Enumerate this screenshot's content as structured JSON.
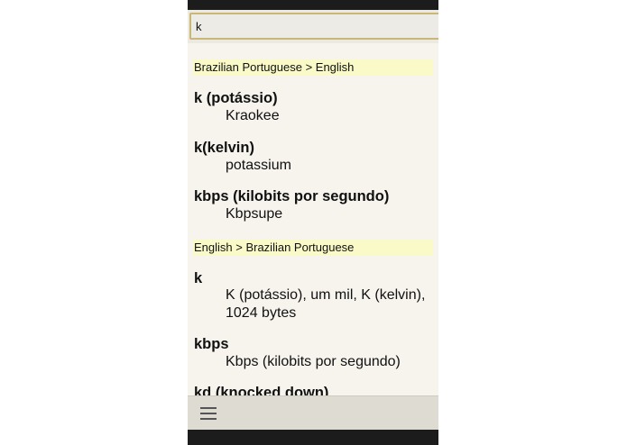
{
  "search": {
    "value": "k"
  },
  "sections": [
    {
      "header": "Brazilian Portuguese > English",
      "entries": [
        {
          "term": "k (potássio)",
          "definition": [
            "Kraokee"
          ]
        },
        {
          "term": "k(kelvin)",
          "definition": [
            "potassium"
          ]
        },
        {
          "term": "kbps (kilobits por segundo)",
          "definition": [
            "Kbpsupe"
          ]
        }
      ]
    },
    {
      "header": "English > Brazilian Portuguese",
      "entries": [
        {
          "term": "k",
          "definition": [
            "K (potássio), um mil, K (kelvin),",
            "1024 bytes"
          ]
        },
        {
          "term": "kbps",
          "definition": [
            "Kbps (kilobits por segundo)"
          ]
        },
        {
          "term": "kd (knocked down)",
          "definition": []
        }
      ]
    }
  ],
  "icons": {
    "menu": "hamburger-menu-icon"
  },
  "colors": {
    "section_header_bg": "#fafac8",
    "search_border": "#c9b777",
    "results_bg": "#f7f4ee",
    "bottom_bar_bg": "#dedbd3"
  }
}
